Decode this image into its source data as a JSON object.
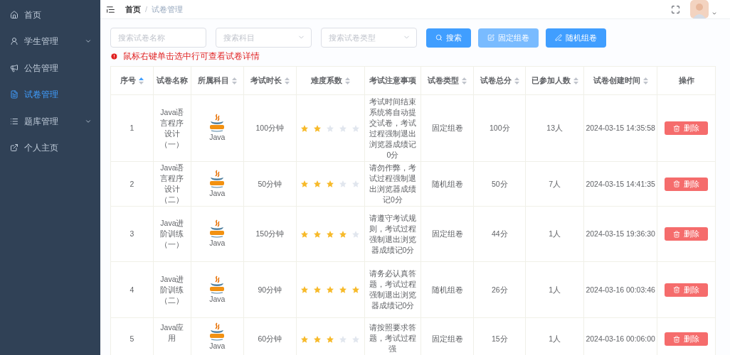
{
  "sidebar": {
    "items": [
      {
        "label": "首页",
        "expandable": false,
        "selected": false
      },
      {
        "label": "学生管理",
        "expandable": true,
        "selected": false
      },
      {
        "label": "公告管理",
        "expandable": false,
        "selected": false
      },
      {
        "label": "试卷管理",
        "expandable": false,
        "selected": true
      },
      {
        "label": "题库管理",
        "expandable": true,
        "selected": false
      },
      {
        "label": "个人主页",
        "expandable": false,
        "selected": false
      }
    ]
  },
  "breadcrumb": [
    "首页",
    "试卷管理"
  ],
  "breadcrumb_separator": "/",
  "filters": [
    {
      "kind": "input",
      "placeholder": "搜索试卷名称"
    },
    {
      "kind": "select",
      "placeholder": "搜索科目"
    },
    {
      "kind": "select",
      "placeholder": "搜索试卷类型"
    }
  ],
  "buttons": [
    {
      "label": "搜索",
      "hovered": false
    },
    {
      "label": "固定组卷",
      "hovered": true
    },
    {
      "label": "随机组卷",
      "hovered": false
    }
  ],
  "hint": "鼠标右键单击选中行可查看试卷详情",
  "table": {
    "columns": [
      {
        "label": "序号",
        "sortable": true,
        "sorted": true
      },
      {
        "label": "试卷名称",
        "sortable": false
      },
      {
        "label": "所属科目",
        "sortable": true,
        "sorted": false
      },
      {
        "label": "考试时长",
        "sortable": true,
        "sorted": false
      },
      {
        "label": "难度系数",
        "sortable": true,
        "sorted": false
      },
      {
        "label": "考试注意事项",
        "sortable": false
      },
      {
        "label": "试卷类型",
        "sortable": true,
        "sorted": false
      },
      {
        "label": "试卷总分",
        "sortable": true,
        "sorted": false
      },
      {
        "label": "已参加人数",
        "sortable": true,
        "sorted": false
      },
      {
        "label": "试卷创建时间",
        "sortable": true,
        "sorted": false
      },
      {
        "label": "操作",
        "sortable": false
      }
    ],
    "rows": [
      {
        "index": "1",
        "name": "Java语言程序设计（一）",
        "subject": "Java",
        "duration": "100分钟",
        "stars": 2,
        "notes": "考试时间结束系统将自动提交试卷，考试过程强制退出浏览器成绩记0分",
        "type": "固定组卷",
        "total": "100分",
        "participants": "13人",
        "created": "2024-03-15 14:35:58",
        "action": "删除"
      },
      {
        "index": "2",
        "name": "Java语言程序设计（二）",
        "subject": "Java",
        "duration": "50分钟",
        "stars": 3,
        "notes": "请勿作弊，考试过程强制退出浏览器成绩记0分",
        "type": "随机组卷",
        "total": "50分",
        "participants": "7人",
        "created": "2024-03-15 14:41:35",
        "action": "删除"
      },
      {
        "index": "3",
        "name": "Java进阶训练（一）",
        "subject": "Java",
        "duration": "150分钟",
        "stars": 4,
        "notes": "请遵守考试规则，考试过程强制退出浏览器成绩记0分",
        "type": "固定组卷",
        "total": "44分",
        "participants": "1人",
        "created": "2024-03-15 19:36:30",
        "action": "删除"
      },
      {
        "index": "4",
        "name": "Java进阶训练（二）",
        "subject": "Java",
        "duration": "90分钟",
        "stars": 5,
        "notes": "请务必认真答题，考试过程强制退出浏览器成绩记0分",
        "type": "随机组卷",
        "total": "26分",
        "participants": "1人",
        "created": "2024-03-16 00:03:46",
        "action": "删除"
      },
      {
        "index": "5",
        "name": "Java应用",
        "subject": "Java",
        "duration": "60分钟",
        "stars": 3,
        "notes": "请按照要求答题，考试过程强",
        "type": "固定组卷",
        "total": "15分",
        "participants": "1人",
        "created": "2024-03-16 00:06:00",
        "action": "删除"
      }
    ]
  }
}
